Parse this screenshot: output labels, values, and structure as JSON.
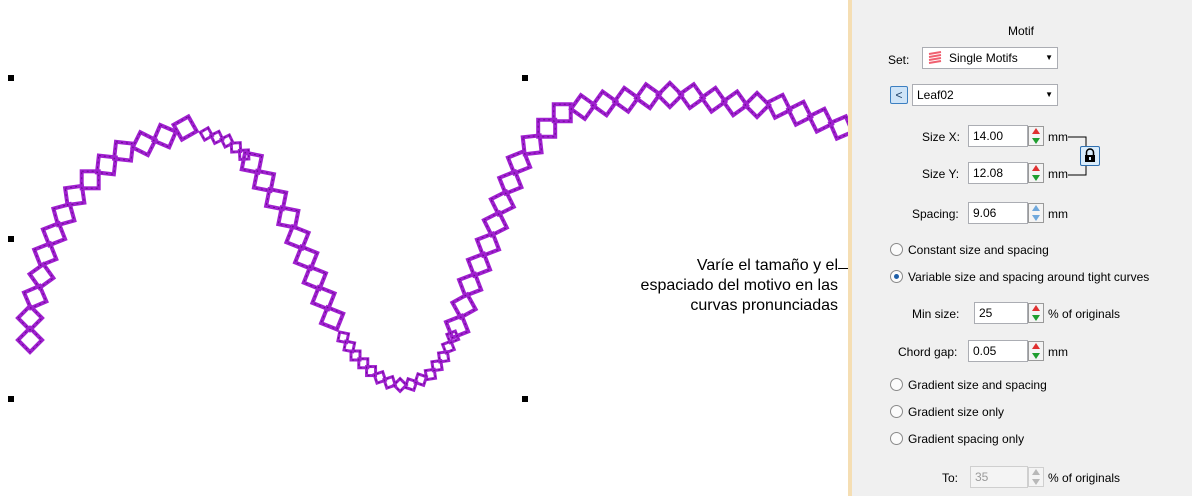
{
  "callout": {
    "line1": "Varíe el tamaño y el",
    "line2": "espaciado del motivo en las",
    "line3": "curvas pronunciadas"
  },
  "panel": {
    "title": "Motif",
    "set_label": "Set:",
    "set_value": "Single Motifs",
    "motif_value": "Leaf02",
    "prev_button": "<",
    "size_x": {
      "label": "Size X:",
      "value": "14.00",
      "unit": "mm"
    },
    "size_y": {
      "label": "Size Y:",
      "value": "12.08",
      "unit": "mm"
    },
    "spacing": {
      "label": "Spacing:",
      "value": "9.06",
      "unit": "mm"
    },
    "options": {
      "constant": "Constant size and spacing",
      "variable": "Variable size and spacing around tight curves",
      "gradient_both": "Gradient size and spacing",
      "gradient_size": "Gradient size only",
      "gradient_spacing": "Gradient spacing only"
    },
    "selected_option": "variable",
    "min_size": {
      "label": "Min size:",
      "value": "25",
      "unit": "% of originals"
    },
    "chord_gap": {
      "label": "Chord gap:",
      "value": "0.05",
      "unit": "mm"
    },
    "to": {
      "label": "To:",
      "value": "35",
      "unit": "% of originals"
    }
  },
  "colors": {
    "stitch": "#a020d0",
    "stitch_dark": "#6a0a90",
    "panel_border": "#f5deb3"
  }
}
